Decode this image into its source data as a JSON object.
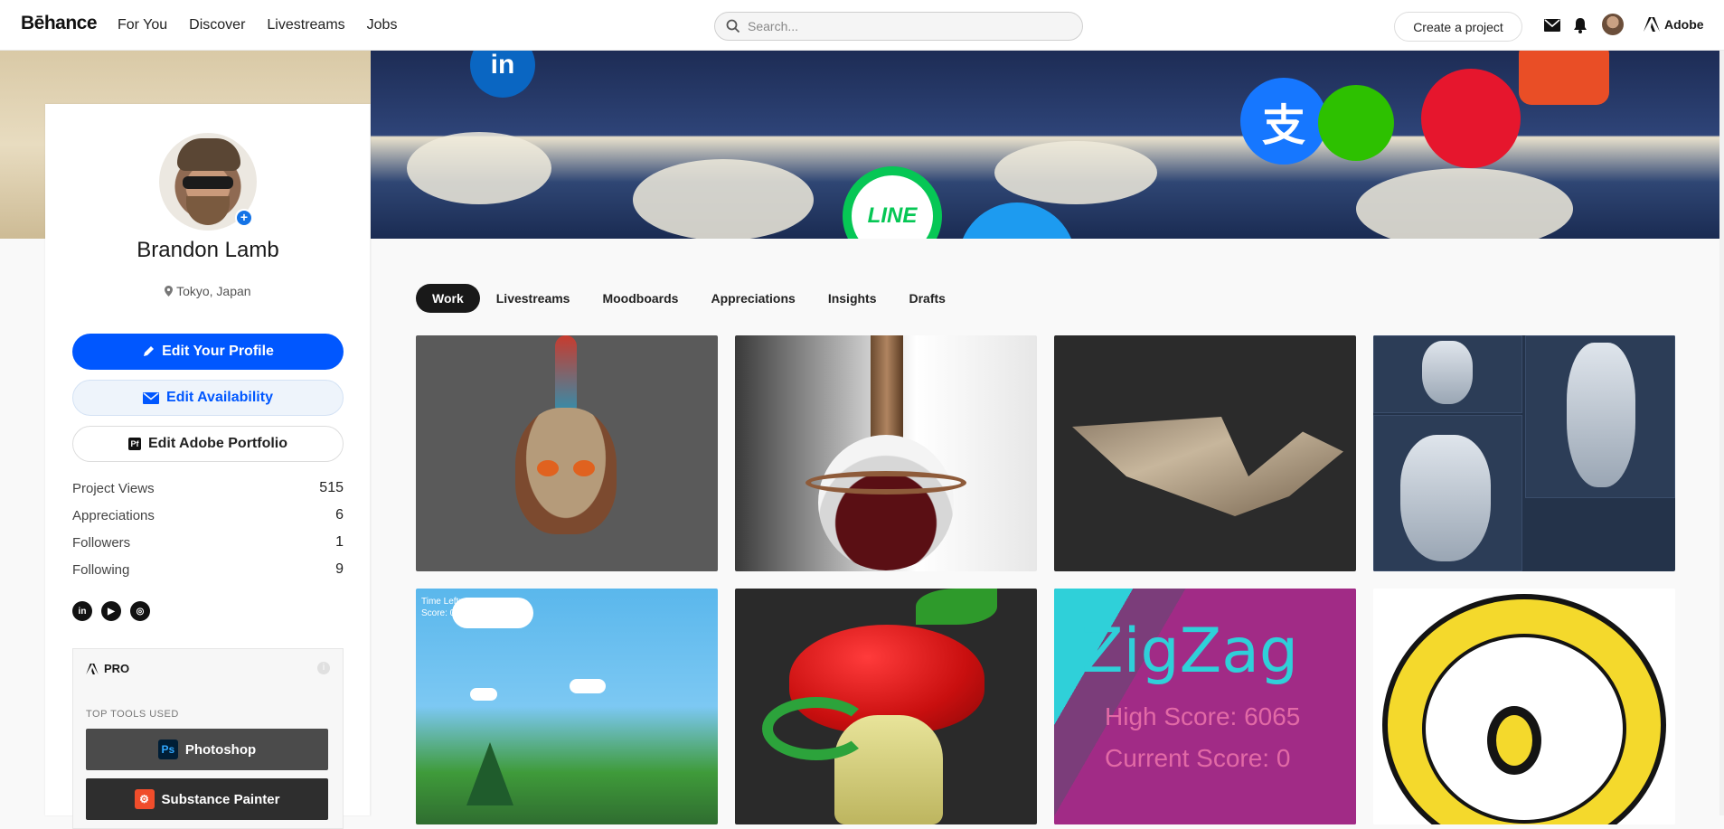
{
  "topbar": {
    "logo": "Bēhance",
    "nav": [
      "For You",
      "Discover",
      "Livestreams",
      "Jobs"
    ],
    "search_placeholder": "Search...",
    "create_label": "Create a project",
    "adobe_label": "Adobe"
  },
  "banner": {
    "line_label": "LINE"
  },
  "profile": {
    "name": "Brandon Lamb",
    "location": "Tokyo, Japan",
    "edit_profile_label": "Edit Your Profile",
    "edit_availability_label": "Edit Availability",
    "edit_portfolio_label": "Edit Adobe Portfolio",
    "stats": [
      {
        "label": "Project Views",
        "value": "515"
      },
      {
        "label": "Appreciations",
        "value": "6"
      },
      {
        "label": "Followers",
        "value": "1"
      },
      {
        "label": "Following",
        "value": "9"
      }
    ],
    "socials": [
      "linkedin-icon",
      "youtube-icon",
      "instagram-icon"
    ],
    "pro": {
      "label": "PRO",
      "tools_label": "TOP TOOLS USED",
      "tools": [
        "Photoshop",
        "Substance Painter"
      ]
    }
  },
  "tabs": [
    "Work",
    "Livestreams",
    "Moodboards",
    "Appreciations",
    "Insights",
    "Drafts"
  ],
  "active_tab": "Work",
  "projects": {
    "game_hud": [
      "Time Left: 11",
      "Score: 0"
    ],
    "zigzag_title": "ZigZag",
    "zigzag_high": "High Score: 6065",
    "zigzag_current": "Current Score:  0"
  },
  "colors": {
    "primary": "#0057ff",
    "accent": "#1473e6"
  }
}
